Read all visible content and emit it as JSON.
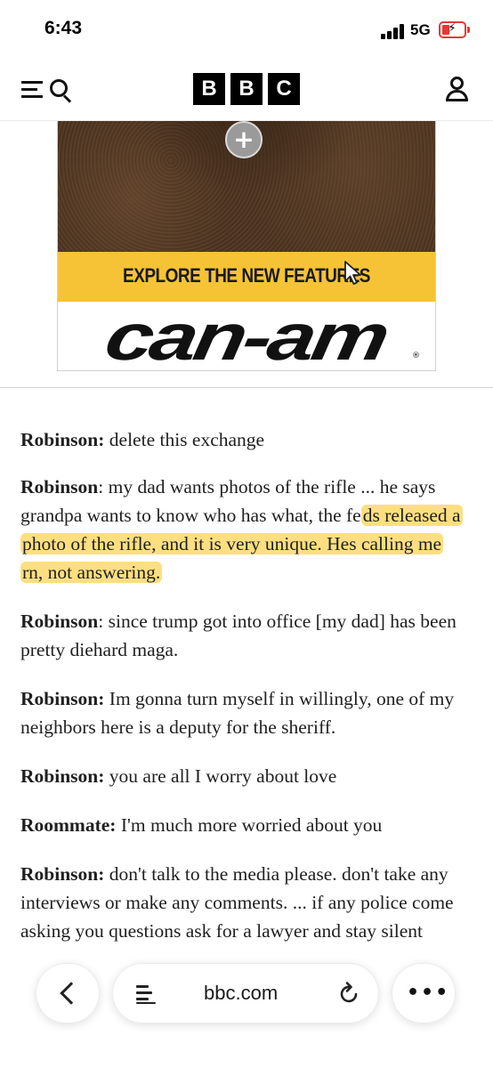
{
  "status_bar": {
    "time": "6:43",
    "network": "5G",
    "battery_level": 0.2,
    "battery_color": "#e53935"
  },
  "header": {
    "logo_letters": [
      "B",
      "B",
      "C"
    ],
    "menu_icon": "menu-search-icon",
    "account_icon": "account-icon"
  },
  "ad": {
    "cta_text": "EXPLORE THE NEW FEATURES",
    "brand_text": "can-am",
    "expand_symbol": "+",
    "registered_mark": "®",
    "banner_color": "#f5c335"
  },
  "article": {
    "paragraphs": [
      {
        "speaker": "Robinson:",
        "text": " delete this exchange"
      },
      {
        "speaker": "Robinson",
        "text_before": ": my dad wants photos of the rifle ... he says grandpa wants to know who has what, the fe",
        "highlighted": "ds released a photo of the rifle, and it is very unique. Hes calling me rn, not answering.",
        "text_after": ""
      },
      {
        "speaker": "Robinson",
        "text": ": since trump got into office [my dad] has been pretty diehard maga."
      },
      {
        "speaker": "Robinson:",
        "text": " Im gonna turn myself in willingly, one of my neighbors here is a deputy for the sheriff."
      },
      {
        "speaker": "Robinson:",
        "text": " you are all I worry about love"
      },
      {
        "speaker": "Roommate:",
        "text": " I'm much more worried about you"
      },
      {
        "speaker": "Robinson:",
        "text": " don't talk to the media please. don't take any interviews or make any comments. ... if any police come asking you questions ask for a lawyer and stay silent"
      }
    ],
    "highlight_color": "#fcc419"
  },
  "browser_bar": {
    "url": "bbc.com",
    "back_icon": "chevron-left-icon",
    "reader_icon": "reader-mode-icon",
    "reload_icon": "reload-icon",
    "more_icon": "more-icon",
    "more_label": "•••"
  }
}
